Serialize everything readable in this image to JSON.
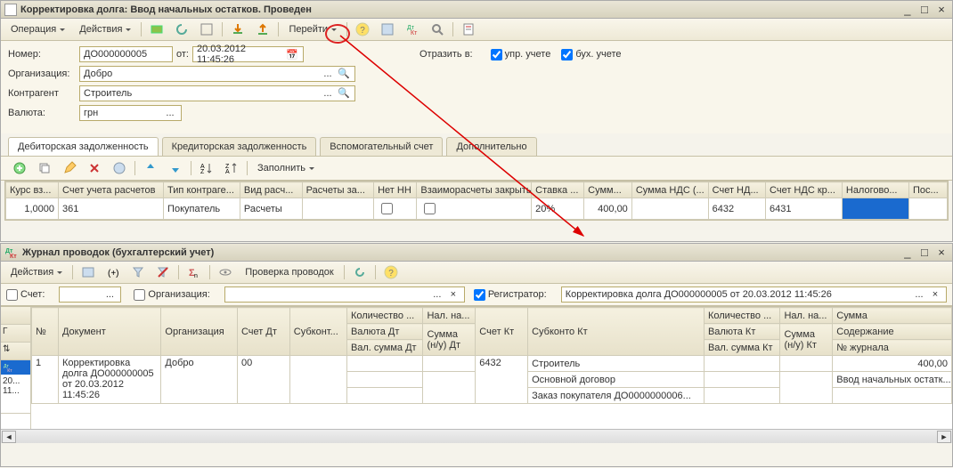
{
  "win1": {
    "title": "Корректировка долга: Ввод начальных остатков. Проведен",
    "menu_operation": "Операция",
    "menu_actions": "Действия",
    "menu_goto": "Перейти",
    "label_number": "Номер:",
    "number": "ДО000000005",
    "label_ot": "от:",
    "date": "20.03.2012 11:45:26",
    "label_reflect": "Отразить в:",
    "check_upr": "упр. учете",
    "check_bukh": "бух. учете",
    "label_org": "Организация:",
    "org": "Добро",
    "label_contr": "Контрагент",
    "contr": "Строитель",
    "label_currency": "Валюта:",
    "currency": "грн"
  },
  "tabs": {
    "deb": "Дебиторская задолженность",
    "kred": "Кредиторская задолженность",
    "aux": "Вспомогательный счет",
    "extra": "Дополнительно"
  },
  "subtb": {
    "fill": "Заполнить"
  },
  "grid1": {
    "h": {
      "kurs": "Курс вз...",
      "acct": "Счет учета расчетов",
      "type": "Тип контраге...",
      "calc": "Вид расч...",
      "calc2": "Расчеты за...",
      "nn": "Нет НН",
      "closed": "Взаиморасчеты закрыты",
      "rate": "Ставка ...",
      "sum": "Сумм...",
      "vat": "Сумма НДС (...",
      "acctnd": "Счет НД...",
      "acctndkr": "Счет НДС кр...",
      "tax": "Налогово...",
      "pos": "Пос..."
    },
    "row": {
      "kurs": "1,0000",
      "acct": "361",
      "type": "Покупатель",
      "calc": "Расчеты",
      "rate": "20%",
      "sum": "400,00",
      "acctnd": "6432",
      "acctndkr": "6431"
    }
  },
  "win2": {
    "title": "Журнал проводок (бухгалтерский учет)",
    "menu_actions": "Действия",
    "check_proverka": "Проверка проводок",
    "label_account": "Счет:",
    "label_org": "Организация:",
    "label_reg": "Регистратор:",
    "reg_value": "Корректировка долга ДО000000005 от 20.03.2012 11:45:26"
  },
  "grid2": {
    "h": {
      "n": "№",
      "doc": "Документ",
      "org": "Организация",
      "dt": "Счет Дт",
      "subdt": "Субконт...",
      "qty": "Количество ...",
      "tax": "Нал. на...",
      "kt": "Счет Кт",
      "subkt": "Субконто Кт",
      "qty2": "Количество ...",
      "tax2": "Нал. на...",
      "sum": "Сумма",
      "valdt": "Валюта Дт",
      "sumnu": "Сумма (н/у) Дт",
      "valsum": "Вал. сумма Дт",
      "valkt": "Валюта Кт",
      "sumnukt": "Сумма (н/у) Кт",
      "valsumkt": "Вал. сумма Кт",
      "content": "Содержание",
      "journal": "№ журнала"
    },
    "row": {
      "period": "20... 11...",
      "n": "1",
      "doc": "Корректировка долга ДО000000005 от 20.03.2012 11:45:26",
      "org": "Добро",
      "dt": "00",
      "kt": "6432",
      "sub1": "Строитель",
      "sub2": "Основной договор",
      "sub3": "Заказ покупателя ДО0000000006...",
      "sum": "400,00",
      "content": "Ввод начальных остатк..."
    }
  }
}
